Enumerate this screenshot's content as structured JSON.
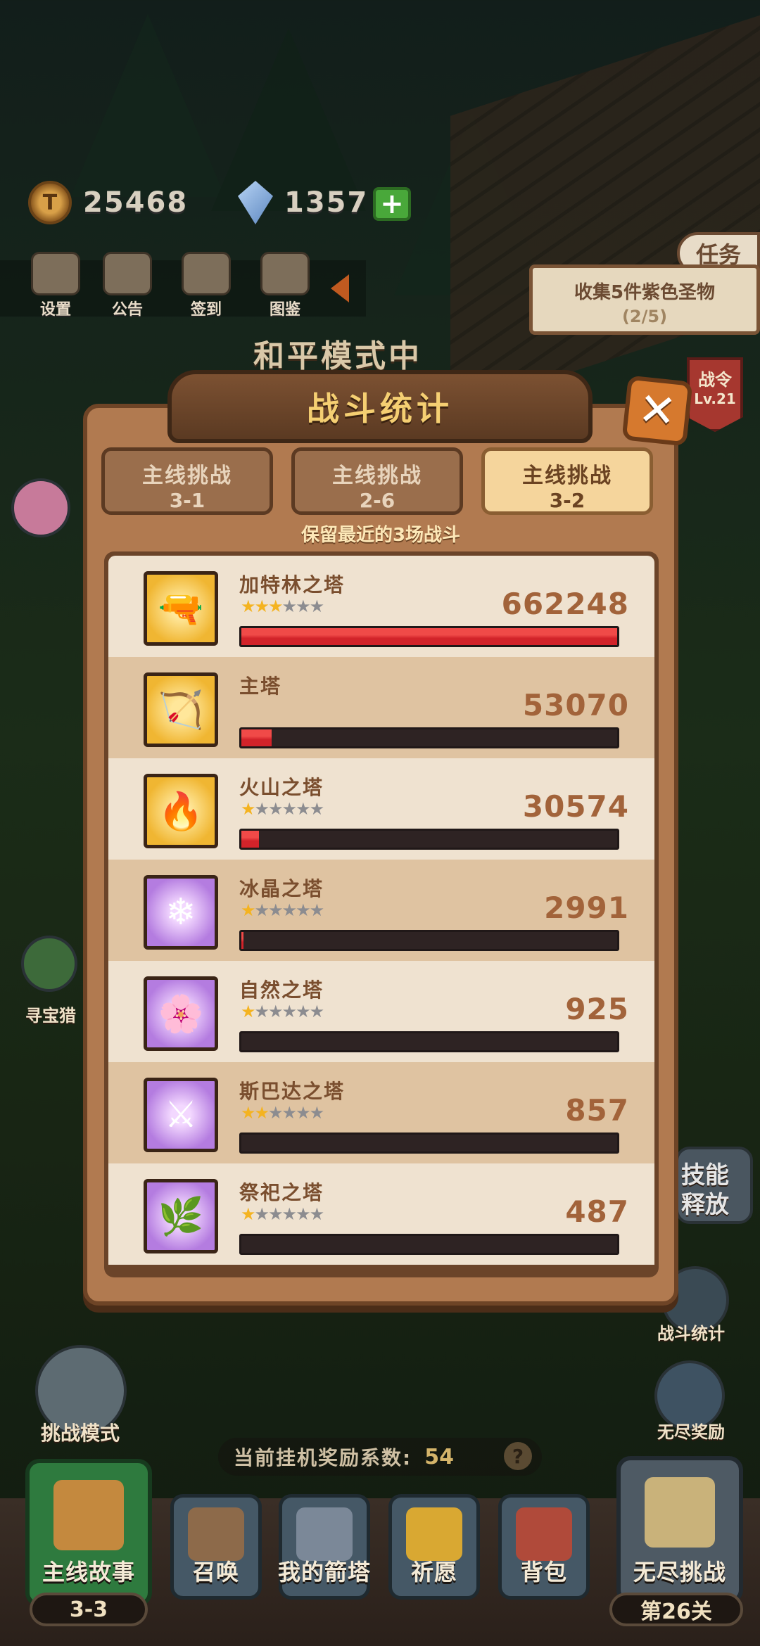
{
  "hud": {
    "gold": "25468",
    "gems": "1357",
    "plus": "+",
    "coin_glyph": "T"
  },
  "menu": [
    {
      "label": "设置",
      "icon": "gear-icon"
    },
    {
      "label": "公告",
      "icon": "scroll-icon"
    },
    {
      "label": "签到",
      "icon": "quill-icon"
    },
    {
      "label": "图鉴",
      "icon": "book-icon"
    }
  ],
  "task": {
    "tab": "任务",
    "text": "收集5件紫色圣物",
    "progress": "(2/5)"
  },
  "battle_pass": {
    "title": "战令",
    "level": "Lv.21"
  },
  "background_text": "和平模式中",
  "modal": {
    "title": "战斗统计",
    "close": "✕",
    "tabs": [
      {
        "line1": "主线挑战",
        "line2": "3-1",
        "active": false
      },
      {
        "line1": "主线挑战",
        "line2": "2-6",
        "active": false
      },
      {
        "line1": "主线挑战",
        "line2": "3-2",
        "active": true
      }
    ],
    "note": "保留最近的3场战斗",
    "rows": [
      {
        "name": "加特林之塔",
        "stars": 3,
        "max_stars": 6,
        "damage": "662248",
        "fraction": 1.0,
        "frame": "gold",
        "glyph": "🔫"
      },
      {
        "name": "主塔",
        "stars": 0,
        "max_stars": 0,
        "damage": "53070",
        "fraction": 0.08,
        "frame": "gold",
        "glyph": "🏹"
      },
      {
        "name": "火山之塔",
        "stars": 1,
        "max_stars": 6,
        "damage": "30574",
        "fraction": 0.046,
        "frame": "gold",
        "glyph": "🔥"
      },
      {
        "name": "冰晶之塔",
        "stars": 1,
        "max_stars": 6,
        "damage": "2991",
        "fraction": 0.005,
        "frame": "purple",
        "glyph": "❄"
      },
      {
        "name": "自然之塔",
        "stars": 1,
        "max_stars": 6,
        "damage": "925",
        "fraction": 0.0,
        "frame": "purple",
        "glyph": "🌸"
      },
      {
        "name": "斯巴达之塔",
        "stars": 2,
        "max_stars": 6,
        "damage": "857",
        "fraction": 0.0,
        "frame": "purple",
        "glyph": "⚔"
      },
      {
        "name": "祭祀之塔",
        "stars": 1,
        "max_stars": 6,
        "damage": "487",
        "fraction": 0.0,
        "frame": "purple",
        "glyph": "🌿"
      }
    ]
  },
  "side": {
    "treasure": "寻宝猎",
    "skill": "技能释放",
    "battle_stats": "战斗统计",
    "endless_reward": "无尽奖励",
    "challenge_mode": "挑战模式"
  },
  "reward": {
    "label": "当前挂机奖励系数:",
    "value": "54",
    "help": "?"
  },
  "nav": {
    "main_story": "主线故事",
    "main_story_level": "3-3",
    "summon": "召唤",
    "my_towers": "我的箭塔",
    "pray": "祈愿",
    "backpack": "背包",
    "endless": "无尽挑战",
    "endless_level": "第26关"
  },
  "colors": {
    "modal_bg": "#b17a50",
    "bar_fill": "#d2232a",
    "star_on": "#f4b320",
    "star_off": "#8c8c90"
  }
}
